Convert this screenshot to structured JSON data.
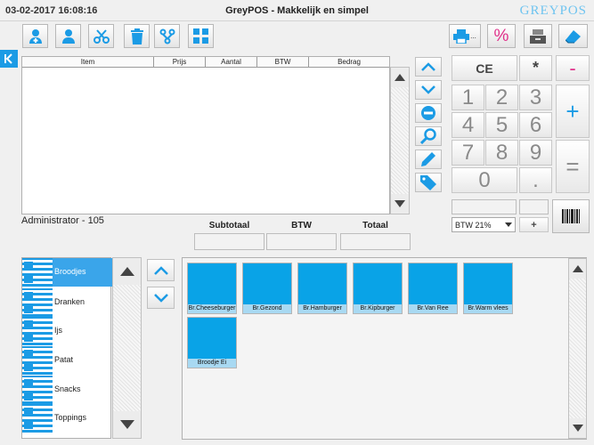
{
  "titlebar": {
    "datetime": "03-02-2017 16:08:16",
    "title": "GreyPOS - Makkelijk en simpel",
    "logo": "GREYPOS"
  },
  "colors": {
    "accent": "#1b9be5",
    "pink": "#e0308a",
    "product_tile": "#09a3e7",
    "selected_category": "#3aa5ea"
  },
  "toolbar": {
    "left_icons": [
      "add-customer-icon",
      "customer-icon",
      "scissors-icon",
      "trash-icon",
      "merge-icon",
      "grid-icon"
    ],
    "right_icons": [
      "printer-icon",
      "percent-icon",
      "cash-drawer-icon",
      "eraser-icon"
    ],
    "printer_suffix": "..."
  },
  "order_table": {
    "columns": [
      "Item",
      "Prijs",
      "Aantal",
      "BTW",
      "Bedrag"
    ],
    "rows": []
  },
  "user_label": "Administrator - 105",
  "totals": {
    "subtotal_label": "Subtotaal",
    "btw_label": "BTW",
    "total_label": "Totaal"
  },
  "keypad": {
    "ce": "CE",
    "multiply": "*",
    "minus": "-",
    "plus": "+",
    "equals": "=",
    "dot": ".",
    "digits": [
      "7",
      "8",
      "9",
      "4",
      "5",
      "6",
      "1",
      "2",
      "3",
      "0"
    ]
  },
  "btw_select": {
    "selected": "BTW 21%"
  },
  "small_plus": "+",
  "categories": [
    {
      "label": "Broodjes",
      "selected": true
    },
    {
      "label": "Dranken",
      "selected": false
    },
    {
      "label": "Ijs",
      "selected": false
    },
    {
      "label": "Patat",
      "selected": false
    },
    {
      "label": "Snacks",
      "selected": false
    },
    {
      "label": "Toppings",
      "selected": false
    }
  ],
  "products": [
    {
      "label": "Br.Cheeseburger"
    },
    {
      "label": "Br.Gezond"
    },
    {
      "label": "Br.Hamburger"
    },
    {
      "label": "Br.Kipburger"
    },
    {
      "label": "Br.Van Ree"
    },
    {
      "label": "Br.Warm vlees"
    },
    {
      "label": "Broodje Ei"
    }
  ]
}
